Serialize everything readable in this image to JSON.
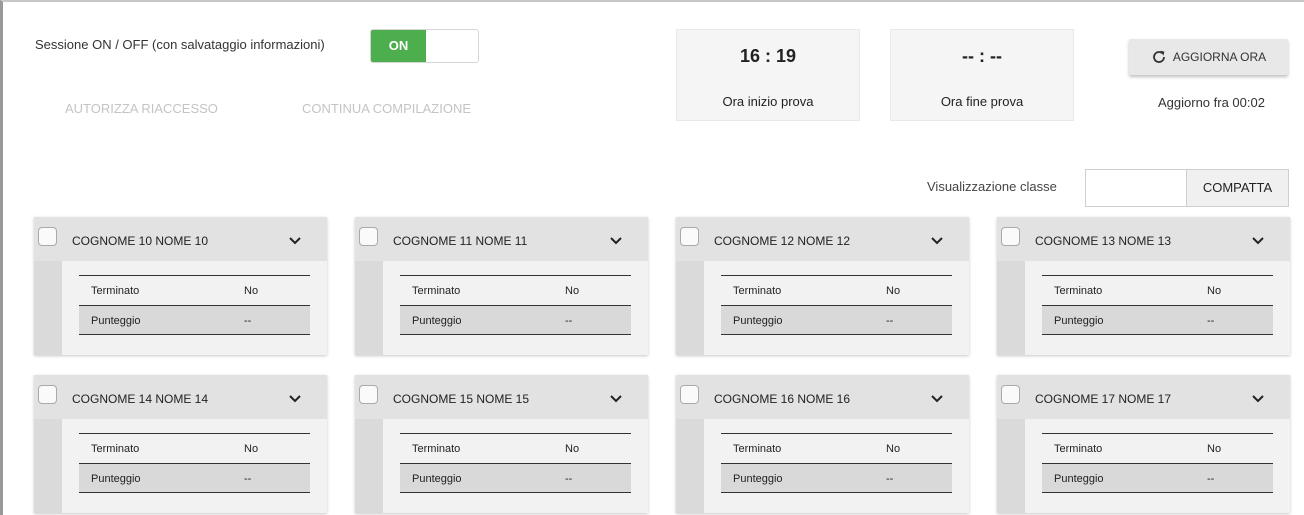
{
  "session": {
    "label": "Sessione ON / OFF (con salvataggio informazioni)",
    "toggle_on_label": "ON",
    "toggle_color": "#4cae4c"
  },
  "actions": {
    "authorize_reentry": "AUTORIZZA RIACCESSO",
    "continue_compilation": "CONTINUA COMPILAZIONE"
  },
  "timer": {
    "start_time": "16 : 19",
    "start_caption": "Ora inizio prova",
    "end_time": "-- : --",
    "end_caption": "Ora fine prova"
  },
  "refresh": {
    "button_label": "AGGIORNA ORA",
    "icon": "refresh-icon",
    "countdown": "Aggiorno fra 00:02"
  },
  "class_view": {
    "label": "Visualizzazione classe",
    "input_value": "",
    "button_label": "COMPATTA"
  },
  "students": [
    {
      "name": "COGNOME 10 NOME 10",
      "rows": [
        {
          "label": "Terminato",
          "value": "No"
        },
        {
          "label": "Punteggio",
          "value": "--"
        }
      ]
    },
    {
      "name": "COGNOME 11 NOME 11",
      "rows": [
        {
          "label": "Terminato",
          "value": "No"
        },
        {
          "label": "Punteggio",
          "value": "--"
        }
      ]
    },
    {
      "name": "COGNOME 12 NOME 12",
      "rows": [
        {
          "label": "Terminato",
          "value": "No"
        },
        {
          "label": "Punteggio",
          "value": "--"
        }
      ]
    },
    {
      "name": "COGNOME 13 NOME 13",
      "rows": [
        {
          "label": "Terminato",
          "value": "No"
        },
        {
          "label": "Punteggio",
          "value": "--"
        }
      ]
    },
    {
      "name": "COGNOME 14 NOME 14",
      "rows": [
        {
          "label": "Terminato",
          "value": "No"
        },
        {
          "label": "Punteggio",
          "value": "--"
        }
      ]
    },
    {
      "name": "COGNOME 15 NOME 15",
      "rows": [
        {
          "label": "Terminato",
          "value": "No"
        },
        {
          "label": "Punteggio",
          "value": "--"
        }
      ]
    },
    {
      "name": "COGNOME 16 NOME 16",
      "rows": [
        {
          "label": "Terminato",
          "value": "No"
        },
        {
          "label": "Punteggio",
          "value": "--"
        }
      ]
    },
    {
      "name": "COGNOME 17 NOME 17",
      "rows": [
        {
          "label": "Terminato",
          "value": "No"
        },
        {
          "label": "Punteggio",
          "value": "--"
        }
      ]
    }
  ]
}
